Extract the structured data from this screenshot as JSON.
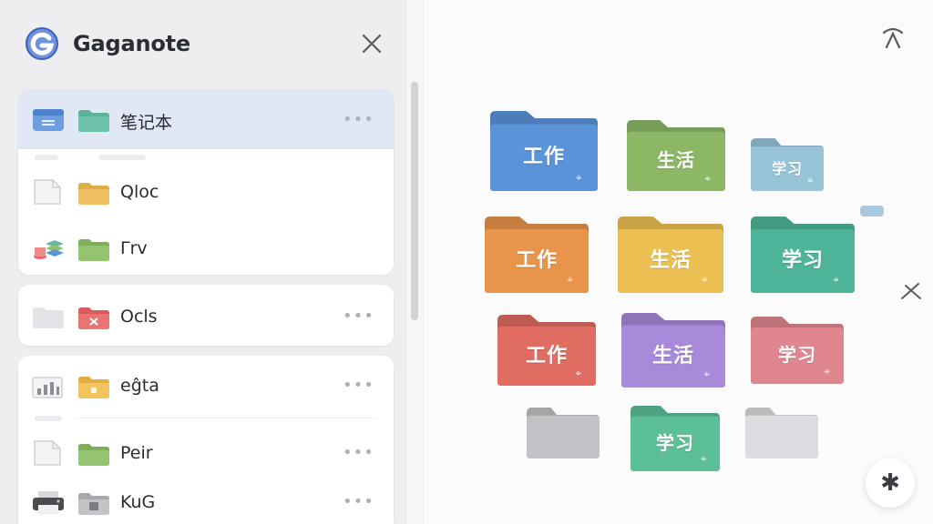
{
  "app": {
    "title": "Gaganote",
    "brand_color": "#4f73c9"
  },
  "sidebar": {
    "groups": [
      {
        "items": [
          {
            "label": "笔记本",
            "lead_icon": "note-card-icon",
            "folder_color": "#5bb39a",
            "selected": true,
            "has_more": true,
            "more": "•••"
          },
          {
            "label": "Qloc",
            "lead_icon": "document-icon",
            "folder_color": "#e9b85a",
            "selected": false,
            "has_more": false
          },
          {
            "label": "Γrv",
            "lead_icon": "stack-icon",
            "folder_color": "#8fbf6a",
            "selected": false,
            "has_more": false
          }
        ]
      },
      {
        "items": [
          {
            "label": "Ocls",
            "lead_icon": "blank-folder-icon",
            "folder_color": "#e36a6a",
            "selected": false,
            "has_more": true,
            "more": "•••"
          }
        ]
      },
      {
        "items": [
          {
            "label": "eĝta",
            "lead_icon": "bar-chart-icon",
            "folder_color": "#efc05a",
            "selected": false,
            "has_more": true,
            "more": "•••"
          },
          {
            "label": "Peir",
            "lead_icon": "document-icon",
            "folder_color": "#8fbf6a",
            "selected": false,
            "has_more": true,
            "more": "•••"
          },
          {
            "label": "KuG",
            "lead_icon": "printer-icon",
            "folder_color": "#b9b9be",
            "selected": false,
            "has_more": true,
            "more": "•••"
          }
        ]
      }
    ]
  },
  "main": {
    "folders": [
      {
        "label": "工作",
        "color": "#5b93d9"
      },
      {
        "label": "生活",
        "color": "#8cb865"
      },
      {
        "label": "学习",
        "color": "#98c4da"
      },
      {
        "label": "工作",
        "color": "#e8944a"
      },
      {
        "label": "生活",
        "color": "#ecbf52"
      },
      {
        "label": "学习",
        "color": "#4fb59a"
      },
      {
        "label": "工作",
        "color": "#e06c62"
      },
      {
        "label": "生活",
        "color": "#a889da"
      },
      {
        "label": "学习",
        "color": "#e0868e"
      },
      {
        "label": "",
        "color": "#c2c2c6"
      },
      {
        "label": "学习",
        "color": "#5cbf98"
      },
      {
        "label": "",
        "color": "#dcdce0"
      }
    ],
    "pin_glyph": "⌖",
    "fab_glyph": "✱"
  }
}
